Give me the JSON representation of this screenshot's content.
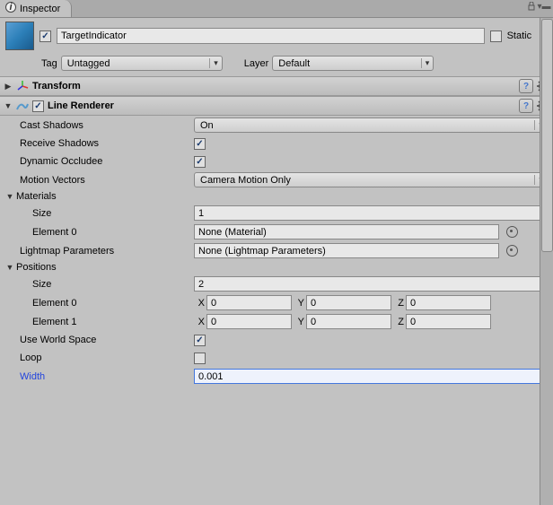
{
  "tab": {
    "title": "Inspector"
  },
  "header": {
    "active": true,
    "name": "TargetIndicator",
    "static_label": "Static",
    "static_checked": false,
    "tag_label": "Tag",
    "tag_value": "Untagged",
    "layer_label": "Layer",
    "layer_value": "Default"
  },
  "transform": {
    "title": "Transform"
  },
  "lineRenderer": {
    "title": "Line Renderer",
    "enabled": true,
    "castShadows": {
      "label": "Cast Shadows",
      "value": "On"
    },
    "receiveShadows": {
      "label": "Receive Shadows",
      "checked": true
    },
    "dynamicOccludee": {
      "label": "Dynamic Occludee",
      "checked": true
    },
    "motionVectors": {
      "label": "Motion Vectors",
      "value": "Camera Motion Only"
    },
    "materials": {
      "label": "Materials",
      "size_label": "Size",
      "size": "1",
      "elements": [
        {
          "label": "Element 0",
          "value": "None (Material)"
        }
      ]
    },
    "lightmapParams": {
      "label": "Lightmap Parameters",
      "value": "None (Lightmap Parameters)"
    },
    "positions": {
      "label": "Positions",
      "size_label": "Size",
      "size": "2",
      "elements": [
        {
          "label": "Element 0",
          "x": "0",
          "y": "0",
          "z": "0"
        },
        {
          "label": "Element 1",
          "x": "0",
          "y": "0",
          "z": "0"
        }
      ]
    },
    "useWorldSpace": {
      "label": "Use World Space",
      "checked": true
    },
    "loop": {
      "label": "Loop",
      "checked": false
    },
    "width": {
      "label": "Width",
      "value": "0.001"
    }
  },
  "axisLabels": {
    "x": "X",
    "y": "Y",
    "z": "Z"
  }
}
